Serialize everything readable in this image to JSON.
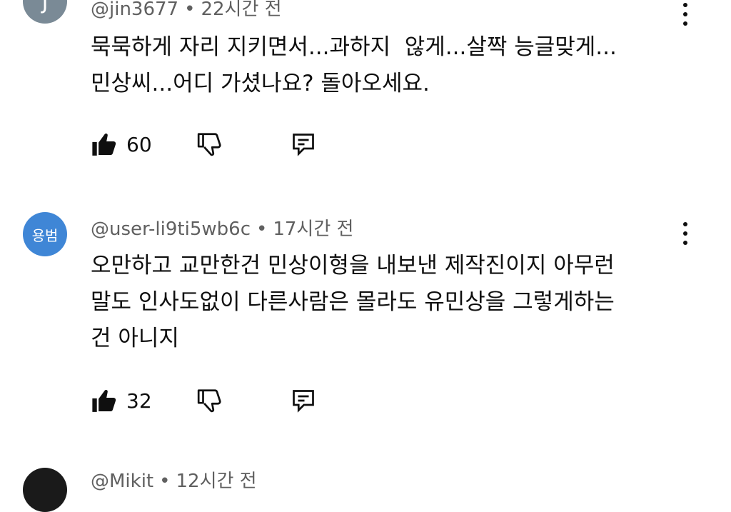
{
  "comments": [
    {
      "avatar_text": "J",
      "avatar_color": "#7a8a96",
      "handle": "@jin3677",
      "separator": "•",
      "time": "22시간 전",
      "text": "묵묵하게 자리 지키면서...과하지  않게...살짝 능글맞게...\n민상씨...어디 가셨나요? 돌아오세요.",
      "likes": "60"
    },
    {
      "avatar_text": "용범",
      "avatar_color": "#3f86d6",
      "handle": "@user-li9ti5wb6c",
      "separator": "•",
      "time": "17시간 전",
      "text": "오만하고 교만한건 민상이형을 내보낸 제작진이지 아무런\n말도 인사도없이 다른사람은 몰라도 유민상을 그렇게하는\n건 아니지",
      "likes": "32"
    },
    {
      "handle": "@Mikit",
      "separator": "•",
      "time": "12시간 전"
    }
  ]
}
